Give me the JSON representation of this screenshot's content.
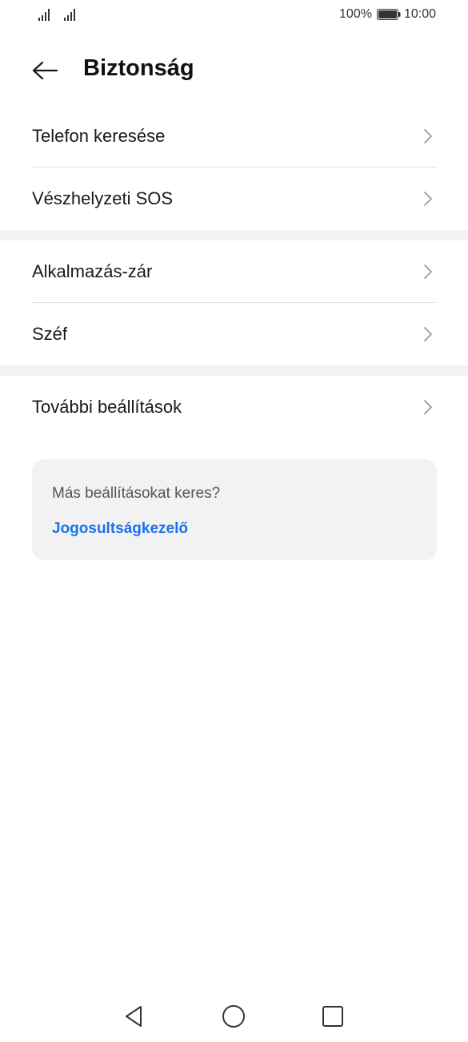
{
  "status_bar": {
    "battery_percent": "100%",
    "time": "10:00",
    "battery_level": 1.0
  },
  "header": {
    "back_icon": "arrow-left-icon",
    "title": "Biztonság"
  },
  "groups": [
    {
      "items": [
        {
          "label": "Telefon keresése",
          "icon": "chevron-right-icon"
        },
        {
          "label": "Vészhelyzeti SOS",
          "icon": "chevron-right-icon"
        }
      ]
    },
    {
      "items": [
        {
          "label": "Alkalmazás-zár",
          "icon": "chevron-right-icon"
        },
        {
          "label": "Széf",
          "icon": "chevron-right-icon"
        }
      ]
    },
    {
      "items": [
        {
          "label": "További beállítások",
          "icon": "chevron-right-icon"
        }
      ]
    }
  ],
  "suggestion_card": {
    "question": "Más beállításokat keres?",
    "link": "Jogosultságkezelő",
    "link_color": "#1a73e8"
  },
  "nav_bar": {
    "back": "triangle-back-icon",
    "home": "circle-home-icon",
    "recent": "square-recents-icon"
  }
}
